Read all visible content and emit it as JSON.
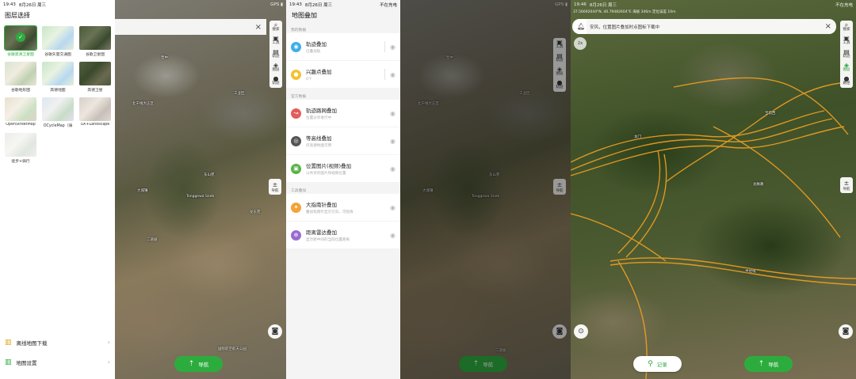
{
  "panel1": {
    "status": {
      "time": "19:43",
      "date": "8月26日 周三",
      "right": "不在充电"
    },
    "title": "图层选择",
    "layers": [
      {
        "label": "谷歌高清卫星图",
        "selected": true,
        "thumb": "t-sat"
      },
      {
        "label": "谷歌矢量交通图",
        "selected": false,
        "thumb": "t-road"
      },
      {
        "label": "谷歌卫星图",
        "selected": false,
        "thumb": "t-sat"
      },
      {
        "label": "谷歌地形图",
        "selected": false,
        "thumb": "t-terrain"
      },
      {
        "label": "高德地图",
        "selected": false,
        "thumb": "t-road"
      },
      {
        "label": "高德卫星",
        "selected": false,
        "thumb": "t-wsat"
      },
      {
        "label": "OpenStreetMap",
        "selected": false,
        "thumb": "t-osm"
      },
      {
        "label": "OCycleMap（骑",
        "selected": false,
        "thumb": "t-cycle"
      },
      {
        "label": "OX+Landscape",
        "selected": false,
        "thumb": "t-land"
      },
      {
        "label": "徒步+骑行",
        "selected": false,
        "thumb": "t-walk"
      }
    ],
    "footer": [
      {
        "label": "离线地图下载",
        "icon": "map-download-icon"
      },
      {
        "label": "地图设置",
        "icon": "map-settings-icon"
      }
    ]
  },
  "map2": {
    "labels": [
      "晋中",
      "北干线大庄区",
      "东山苑",
      "Tonggewa Sneb",
      "大城镇",
      "工业区",
      "二道坡",
      "国际航空航天公园",
      "龙东苑"
    ],
    "tools": [
      "搜索",
      "工具",
      "轨迹",
      "图层",
      "轨迹"
    ],
    "compass_label": "导航",
    "nav_label": "导航"
  },
  "panel3": {
    "status": {
      "time": "19:43",
      "date": "8月26日 周三",
      "right": "不在充电"
    },
    "title": "地图叠加",
    "sections": [
      {
        "label": "我的数据",
        "rows": [
          {
            "name": "轨迹叠加",
            "sub": "已叠加轨",
            "color": "#3daee9",
            "glyph": "◉",
            "icon": "track-pin-icon"
          },
          {
            "name": "兴趣点叠加",
            "sub": "0个",
            "color": "#f5c133",
            "glyph": "●",
            "icon": "poi-pin-icon"
          }
        ]
      },
      {
        "label": "官方数据",
        "rows": [
          {
            "name": "轨迹路网叠加",
            "sub": "位置分享进行中",
            "color": "#e35d5b",
            "glyph": "↝",
            "icon": "track-network-icon"
          },
          {
            "name": "等高线叠加",
            "sub": "仅高德地图可用",
            "color": "#555555",
            "glyph": "◎",
            "icon": "contour-icon"
          },
          {
            "name": "位置图片(视频)叠加",
            "sub": "以共享的图片和视频位置",
            "color": "#59b34a",
            "glyph": "▣",
            "icon": "photo-location-icon"
          }
        ]
      },
      {
        "label": "工具叠加",
        "rows": [
          {
            "name": "大指南针叠加",
            "sub": "叠加指南针显示方向，可指挥",
            "color": "#f2a33a",
            "glyph": "✦",
            "icon": "compass-overlay-icon"
          },
          {
            "name": "距离雷达叠加",
            "sub": "显示距中间的当前位置距离",
            "color": "#9a6bd0",
            "glyph": "⊕",
            "icon": "radar-overlay-icon"
          }
        ]
      }
    ]
  },
  "map4": {
    "labels": [
      "晋中",
      "北干线大庄区",
      "东山苑",
      "Tonggewa Sneb",
      "大城镇",
      "工业区",
      "二道坡"
    ],
    "tools": [
      "搜索",
      "工具",
      "轨迹",
      "图层",
      "轨迹"
    ],
    "compass_label": "导航",
    "nav_label": "导航"
  },
  "panel5": {
    "status": {
      "time": "19:46",
      "date": "8月26日 周三",
      "right": "不在充电"
    },
    "coord": "37.56692044°N, 40.79482604°E  海拔 346m  定位误差 10m",
    "tip": "安风，位置图片叠加时点图标下载中",
    "zoom": "2x",
    "labels": [
      "宝塔西",
      "龙脉路",
      "半径线",
      "龙门"
    ],
    "tools": [
      "搜索",
      "工具",
      "轨迹",
      "图层",
      "路径"
    ],
    "compass_label": "导航",
    "rec_label": "记录",
    "nav_label": "导航"
  },
  "colors": {
    "accent": "#2dac3e",
    "track": "#f0a020"
  }
}
